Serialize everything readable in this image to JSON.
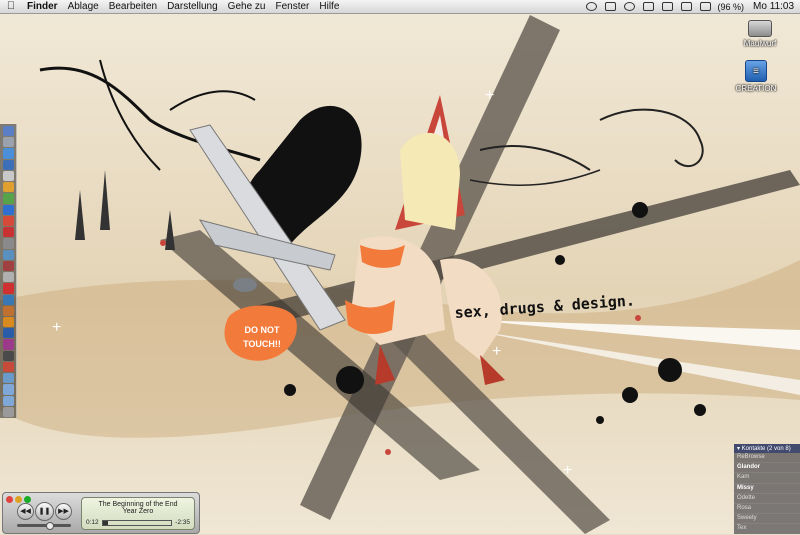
{
  "menubar": {
    "app": "Finder",
    "items": [
      "Ablage",
      "Bearbeiten",
      "Darstellung",
      "Gehe zu",
      "Fenster",
      "Hilfe"
    ],
    "battery": "(96 %)",
    "clock": "Mo 11:03"
  },
  "desktop_icons": [
    {
      "label": "Maulwurf",
      "icon": "hard-disk-icon"
    },
    {
      "label": "CREATION",
      "icon": "external-disk-icon"
    }
  ],
  "wallpaper": {
    "sign_text_1": "DO NOT",
    "sign_text_2": "TOUCH!!",
    "slogan": "sex, drugs & design."
  },
  "contacts_widget": {
    "header": "▾ Kontakte (2 von 8)",
    "names": [
      "ReBrowse",
      "Glandor",
      "Kam",
      "Missy",
      "Odette",
      "Rosa",
      "Sweety",
      "Tex"
    ]
  },
  "itunes": {
    "track": "The Beginning of the End",
    "artist": "Year Zero",
    "elapsed": "0:12",
    "remaining": "-2:35",
    "progress": 0.08,
    "volume": 0.6,
    "buttons": {
      "prev": "◀◀",
      "play": "❚❚",
      "next": "▶▶"
    }
  },
  "colors": {
    "wallpaper_base": "#e8dcc4",
    "accent_orange": "#f27a3a",
    "ink": "#111111"
  }
}
